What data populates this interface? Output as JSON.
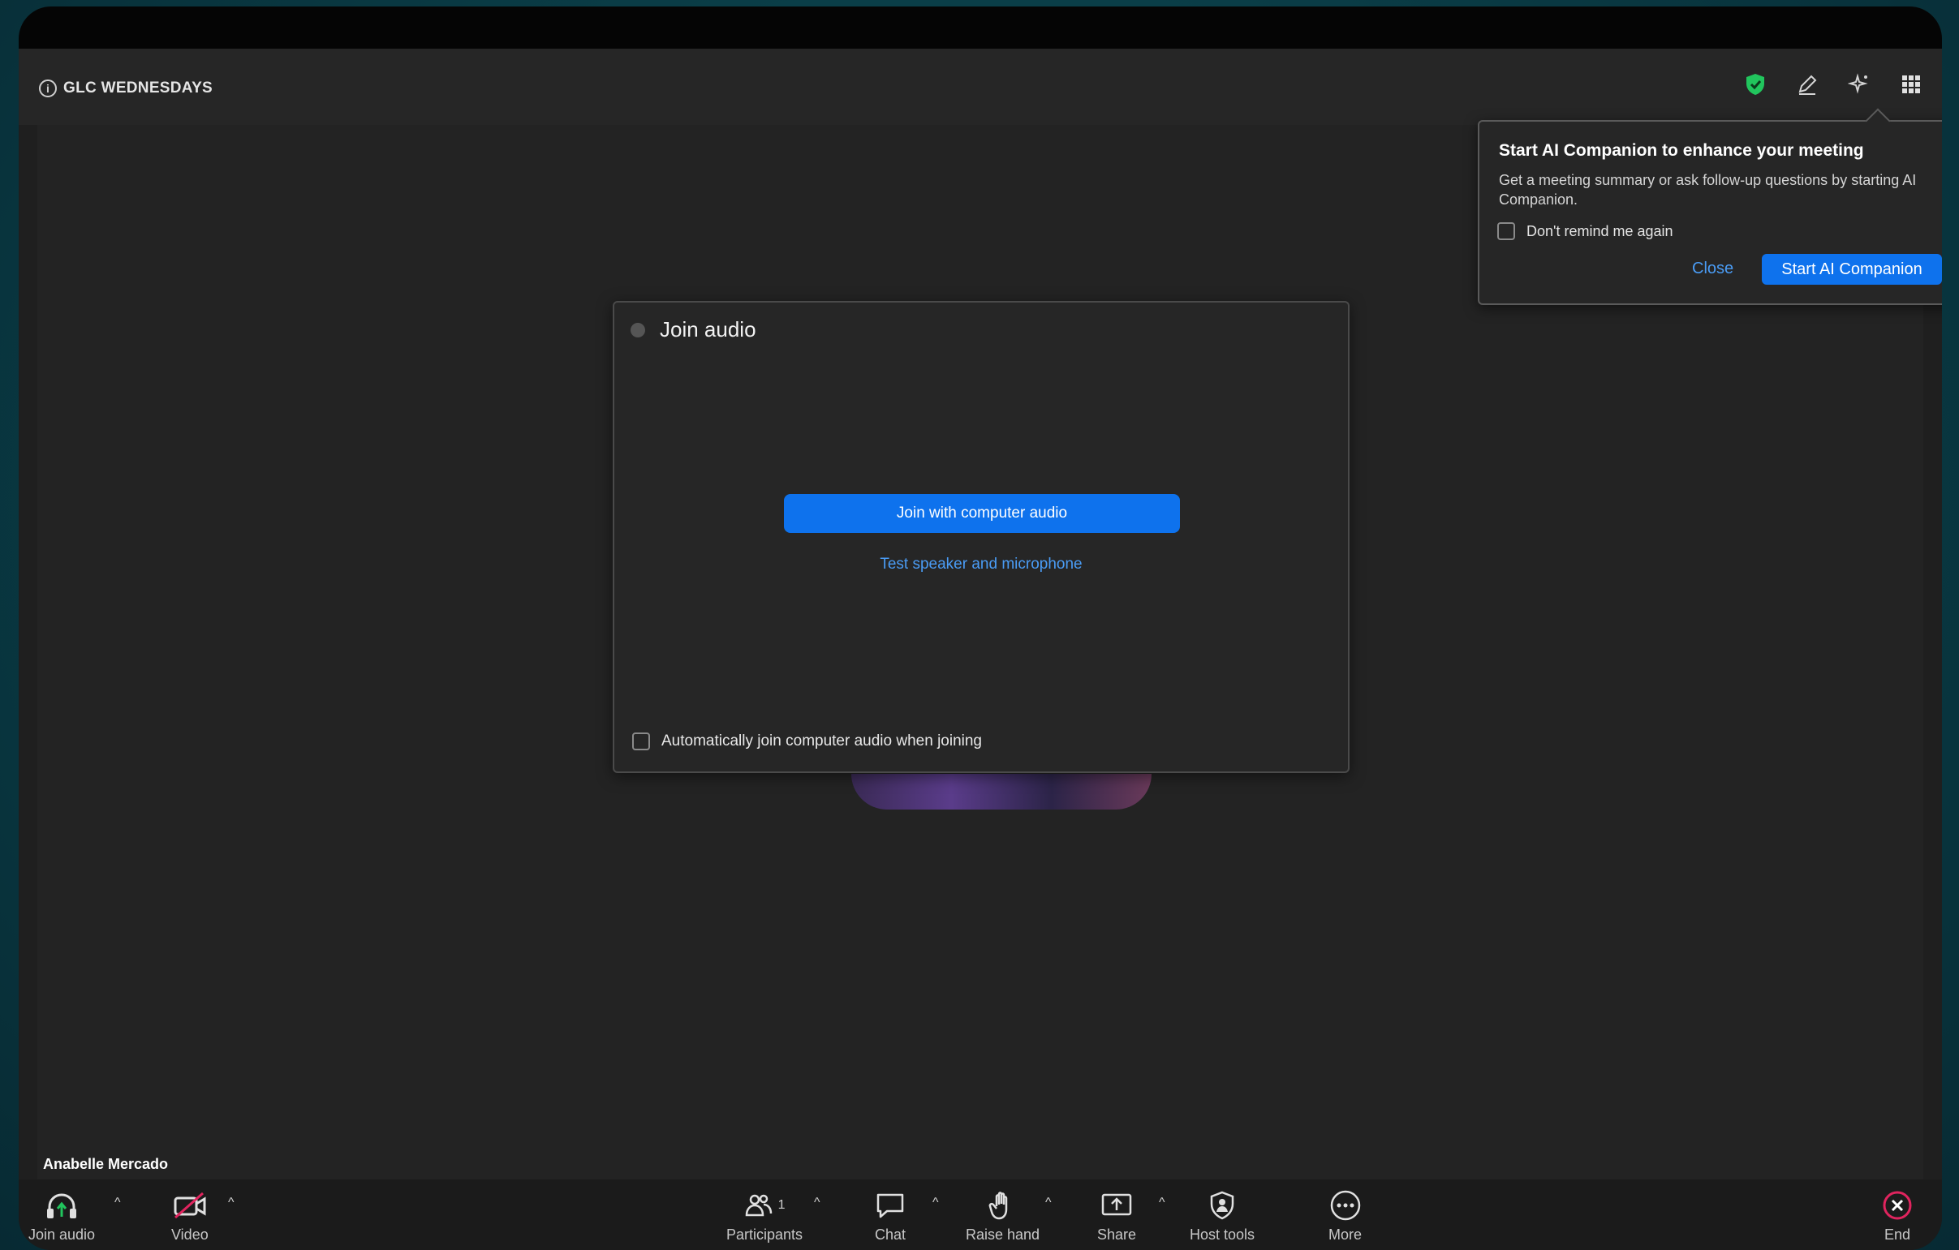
{
  "meeting": {
    "title": "GLC WEDNESDAYS"
  },
  "colors": {
    "accent": "#0e72ed",
    "link": "#4a9cf5",
    "secure": "#21c55d",
    "end": "#e0245e"
  },
  "top_icons": [
    "shield-check-icon",
    "pen-icon",
    "ai-sparkle-icon",
    "grid-icon"
  ],
  "participant": {
    "name": "Anabelle Mercado"
  },
  "audio_dialog": {
    "title": "Join audio",
    "join_button": "Join with computer audio",
    "test_link": "Test speaker and microphone",
    "auto_join_label": "Automatically join computer audio when joining",
    "auto_join_checked": false
  },
  "ai_popup": {
    "title": "Start AI Companion to enhance your meeting",
    "description": "Get a meeting summary or ask follow-up questions by starting AI Companion.",
    "remind_label": "Don't remind me again",
    "close_label": "Close",
    "start_label": "Start AI Companion"
  },
  "toolbar": {
    "join_audio": "Join audio",
    "video": "Video",
    "participants": "Participants",
    "participants_count": "1",
    "chat": "Chat",
    "raise_hand": "Raise hand",
    "share": "Share",
    "host_tools": "Host tools",
    "more": "More",
    "end": "End"
  }
}
